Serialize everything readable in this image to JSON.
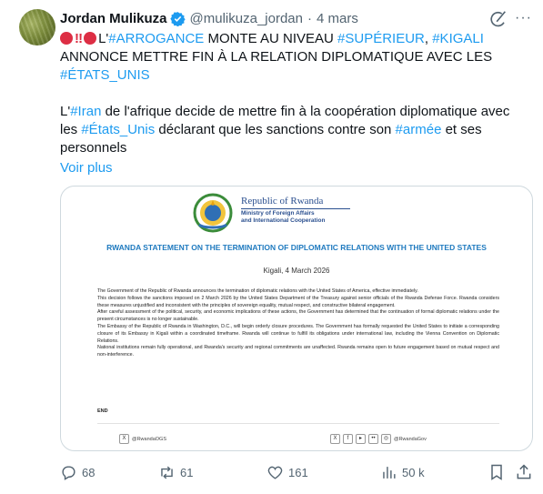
{
  "author": {
    "name": "Jordan Mulikuza",
    "handle": "@mulikuza_jordan",
    "separator": "·",
    "time": "4 mars"
  },
  "tweet": {
    "p1": [
      {
        "t": "L'"
      },
      {
        "t": "#ARROGANCE",
        "tag": true
      },
      {
        "t": " MONTE AU NIVEAU "
      },
      {
        "t": "#SUPÉRIEUR",
        "tag": true
      },
      {
        "t": ", "
      },
      {
        "t": "#KIGALI",
        "tag": true
      },
      {
        "t": " ANNONCE METTRE FIN À LA RELATION DIPLOMATIQUE AVEC LES "
      },
      {
        "t": "#ÉTATS_UNIS",
        "tag": true
      }
    ],
    "p2": [
      {
        "t": "L'"
      },
      {
        "t": "#Iran",
        "tag": true
      },
      {
        "t": " de l'afrique decide de mettre fin à la coopération diplomatique avec les "
      },
      {
        "t": "#États_Unis",
        "tag": true
      },
      {
        "t": " déclarant que les sanctions contre son "
      },
      {
        "t": "#armée",
        "tag": true
      },
      {
        "t": " et ses personnels"
      }
    ],
    "show_more": "Voir plus"
  },
  "document": {
    "header_line1": "Republic of Rwanda",
    "header_line2": "Ministry of Foreign Affairs",
    "header_line3": "and International Cooperation",
    "title": "RWANDA  STATEMENT ON THE TERMINATION OF DIPLOMATIC RELATIONS WITH THE UNITED STATES",
    "date": "Kigali, 4 March 2026",
    "paragraphs": [
      "The Government of the Republic of Rwanda announces the termination of diplomatic relations with the United States of America, effective immediately.",
      "This decision follows the sanctions imposed on 2 March 2026 by the United States Department of the Treasury against senior officials of the Rwanda Defense Force. Rwanda considers these measures unjustified and inconsistent with the principles of sovereign equality, mutual respect, and constructive bilateral engagement.",
      "After careful assessment of the political, security, and economic implications of these actions, the Government has determined that the continuation of formal diplomatic relations under the present circumstances is no longer sustainable.",
      "The Embassy of the Republic of Rwanda in Washington, D.C., will begin orderly closure procedures. The Government has formally requested the United States to initiate a corresponding closure of its Embassy in Kigali within a coordinated timeframe. Rwanda will continue to fulfill its obligations under international law, including the Vienna Convention on Diplomatic Relations.",
      "National institutions remain fully operational, and Rwanda's security and regional commitments are unaffected. Rwanda remains open to future engagement based on mutual respect and non-interference."
    ],
    "end": "END",
    "footer_left": "@RwandaOGS",
    "footer_right": "@RwandaGov"
  },
  "actions": {
    "replies": "68",
    "reposts": "61",
    "likes": "161",
    "views": "50 k"
  },
  "colors": {
    "accent": "#1d9bf0",
    "muted": "#536471",
    "doc_blue": "#1f7abf"
  }
}
